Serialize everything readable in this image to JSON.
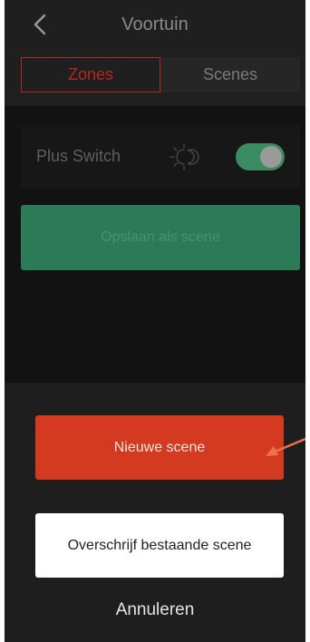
{
  "header": {
    "title": "Voortuin",
    "back_icon": "chevron-left-icon"
  },
  "tabs": [
    {
      "label": "Zones",
      "active": true
    },
    {
      "label": "Scenes",
      "active": false
    }
  ],
  "switch_row": {
    "label": "Plus Switch",
    "daynight_icon": "sun-moon-icon",
    "toggle_on": true
  },
  "save_button": {
    "label": "Opslaan als scene"
  },
  "action_sheet": {
    "new_scene_label": "Nieuwe scene",
    "overwrite_label": "Overschrijf bestaande scene",
    "cancel_label": "Annuleren"
  },
  "colors": {
    "accent_red": "#d33a1f",
    "accent_green": "#2c7a58",
    "annotation_arrow": "#e8744a"
  }
}
